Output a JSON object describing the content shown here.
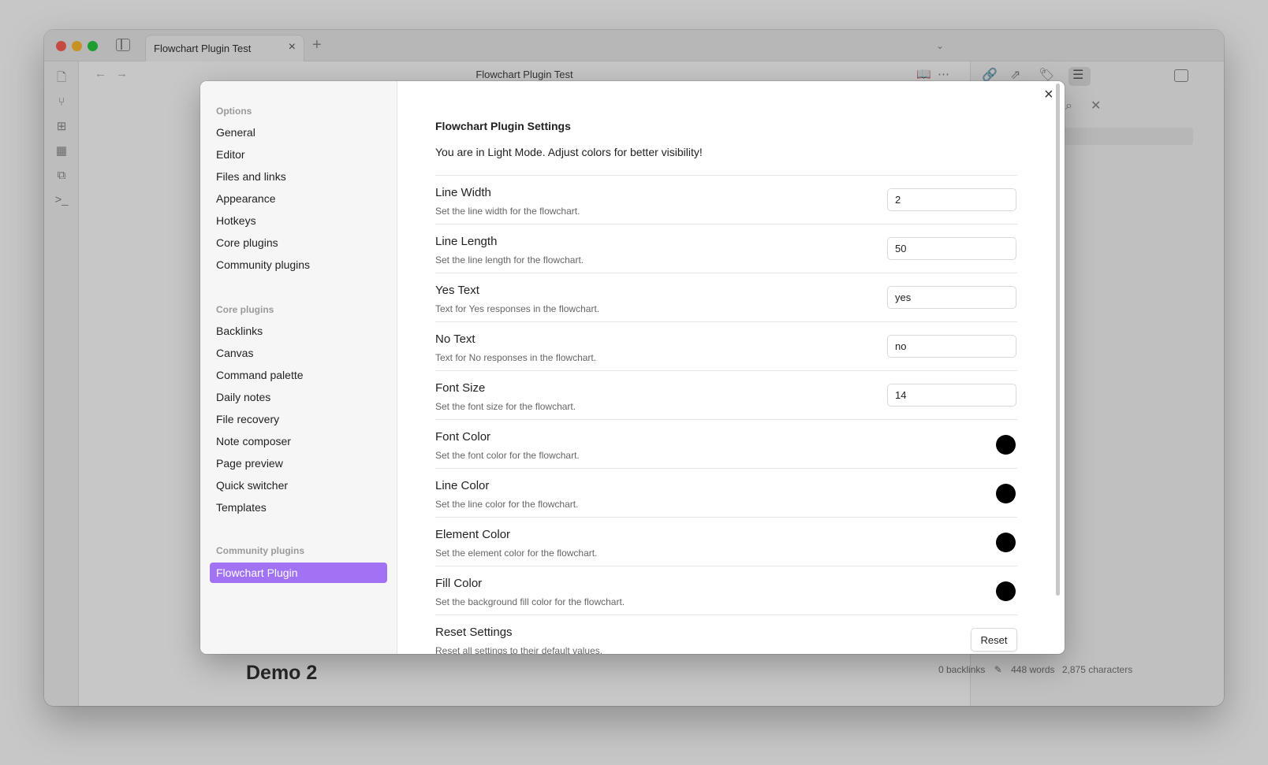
{
  "window": {
    "tab_title": "Flowchart Plugin Test",
    "tab_close": "×",
    "tab_plus": "+",
    "editor_title": "Flowchart Plugin Test",
    "demo_heading": "Demo 2",
    "status": {
      "backlinks": "0 backlinks",
      "words": "448 words",
      "characters": "2,875 characters"
    }
  },
  "modal": {
    "close": "×",
    "sidebar": {
      "options_heading": "Options",
      "options": [
        "General",
        "Editor",
        "Files and links",
        "Appearance",
        "Hotkeys",
        "Core plugins",
        "Community plugins"
      ],
      "core_heading": "Core plugins",
      "core": [
        "Backlinks",
        "Canvas",
        "Command palette",
        "Daily notes",
        "File recovery",
        "Note composer",
        "Page preview",
        "Quick switcher",
        "Templates"
      ],
      "community_heading": "Community plugins",
      "community": [
        "Flowchart Plugin"
      ]
    },
    "title": "Flowchart Plugin Settings",
    "description": "You are in Light Mode. Adjust colors for better visibility!",
    "settings": [
      {
        "name": "Line Width",
        "desc": "Set the line width for the flowchart.",
        "value": "2"
      },
      {
        "name": "Line Length",
        "desc": "Set the line length for the flowchart.",
        "value": "50"
      },
      {
        "name": "Yes Text",
        "desc": "Text for Yes responses in the flowchart.",
        "value": "yes"
      },
      {
        "name": "No Text",
        "desc": "Text for No responses in the flowchart.",
        "value": "no"
      },
      {
        "name": "Font Size",
        "desc": "Set the font size for the flowchart.",
        "value": "14"
      },
      {
        "name": "Font Color",
        "desc": "Set the font color for the flowchart.",
        "color": "#000000"
      },
      {
        "name": "Line Color",
        "desc": "Set the line color for the flowchart.",
        "color": "#000000"
      },
      {
        "name": "Element Color",
        "desc": "Set the element color for the flowchart.",
        "color": "#000000"
      },
      {
        "name": "Fill Color",
        "desc": "Set the background fill color for the flowchart.",
        "color": "#000000"
      },
      {
        "name": "Reset Settings",
        "desc": "Reset all settings to their default values.",
        "button": "Reset"
      }
    ]
  },
  "colors": {
    "accent": "#a172f4",
    "traffic_red": "#fe5f57",
    "traffic_yellow": "#febc2e",
    "traffic_green": "#28c840"
  },
  "icons": {
    "ribbon": [
      "file-icon",
      "graph-icon",
      "blocks-icon",
      "calendar-icon",
      "copy-icon",
      "terminal-icon"
    ],
    "right_toolbar": [
      "link-icon",
      "outgoing-link-icon",
      "tags-icon",
      "outline-icon",
      "sidebar-right-icon"
    ]
  }
}
